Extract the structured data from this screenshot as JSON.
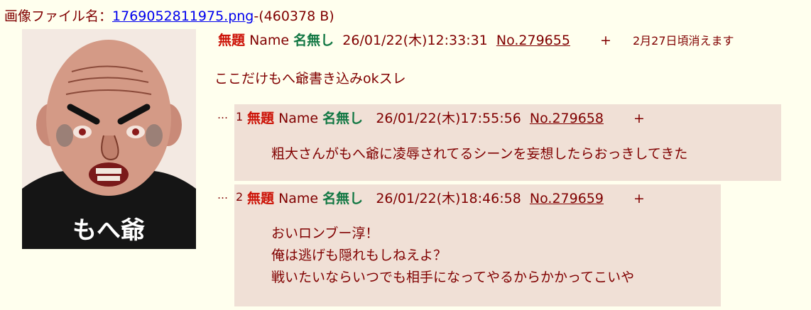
{
  "file": {
    "label": "画像ファイル名：",
    "filename": "1769052811975.png",
    "size": "-(460378 B)"
  },
  "thumbnail": {
    "caption": "もへ爺"
  },
  "op": {
    "subject": "無題",
    "name_label": "Name",
    "name": "名無し",
    "datetime": "26/01/22(木)12:33:31",
    "number": "No.279655",
    "plus": "+",
    "expire": "2月27日頃消えます",
    "body": "ここだけもへ爺書き込みokスレ"
  },
  "replies": [
    {
      "dots": "…",
      "index": "1",
      "subject": "無題",
      "name_label": "Name",
      "name": "名無し",
      "datetime": "26/01/22(木)17:55:56",
      "number": "No.279658",
      "plus": "+",
      "lines": [
        "粗大さんがもへ爺に凌辱されてるシーンを妄想したらおっきしてきた"
      ]
    },
    {
      "dots": "…",
      "index": "2",
      "subject": "無題",
      "name_label": "Name",
      "name": "名無し",
      "datetime": "26/01/22(木)18:46:58",
      "number": "No.279659",
      "plus": "+",
      "lines": [
        "おいロンブー淳！",
        "俺は逃げも隠れもしねえよ？",
        "戦いたいならいつでも相手になってやるからかかってこいや"
      ]
    }
  ]
}
